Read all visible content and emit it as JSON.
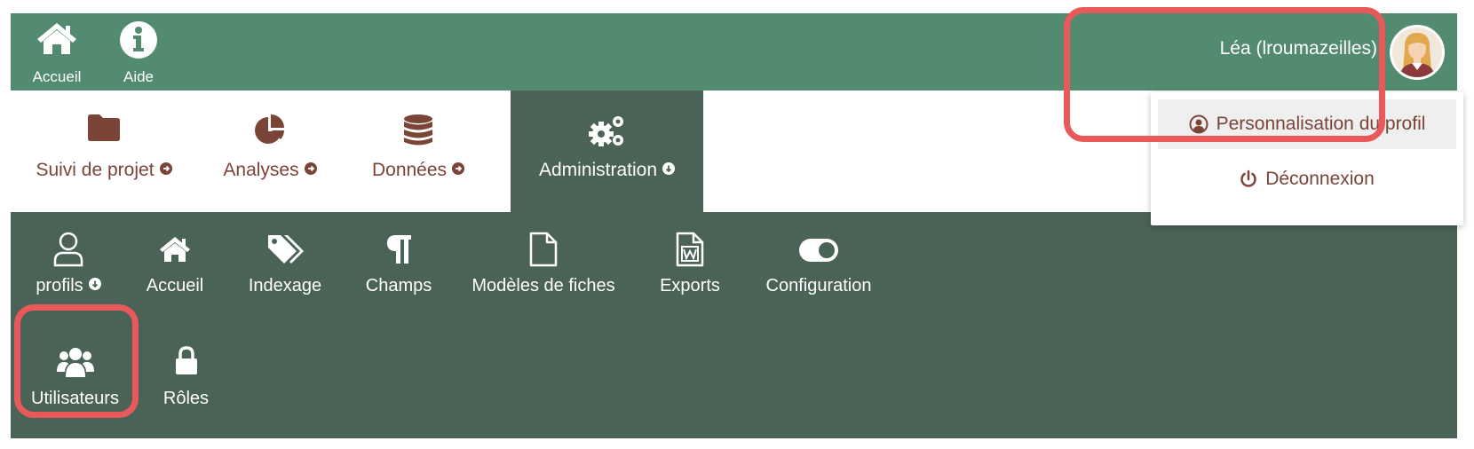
{
  "topbar": {
    "home_label": "Accueil",
    "help_label": "Aide",
    "user_name": "Léa (lroumazeilles)"
  },
  "mainnav": {
    "tabs": [
      {
        "label": "Suivi de projet",
        "icon": "folder-icon"
      },
      {
        "label": "Analyses",
        "icon": "pie-chart-icon"
      },
      {
        "label": "Données",
        "icon": "database-icon"
      },
      {
        "label": "Administration",
        "icon": "gears-icon",
        "active": true
      }
    ]
  },
  "subnav": {
    "items": [
      {
        "label": "profils",
        "icon": "user-outline-icon"
      },
      {
        "label": "Accueil",
        "icon": "home-icon"
      },
      {
        "label": "Indexage",
        "icon": "tags-icon"
      },
      {
        "label": "Champs",
        "icon": "paragraph-icon"
      },
      {
        "label": "Modèles de fiches",
        "icon": "file-icon"
      },
      {
        "label": "Exports",
        "icon": "word-file-icon"
      },
      {
        "label": "Configuration",
        "icon": "toggle-icon"
      }
    ],
    "sub_items": [
      {
        "label": "Utilisateurs",
        "icon": "users-icon"
      },
      {
        "label": "Rôles",
        "icon": "lock-icon"
      }
    ]
  },
  "dropdown": {
    "profile_label": "Personnalisation du profil",
    "logout_label": "Déconnexion"
  },
  "colors": {
    "topbar": "#528b6f",
    "panel": "#4b6357",
    "brand_text": "#7a4437",
    "highlight": "#e9595a"
  }
}
